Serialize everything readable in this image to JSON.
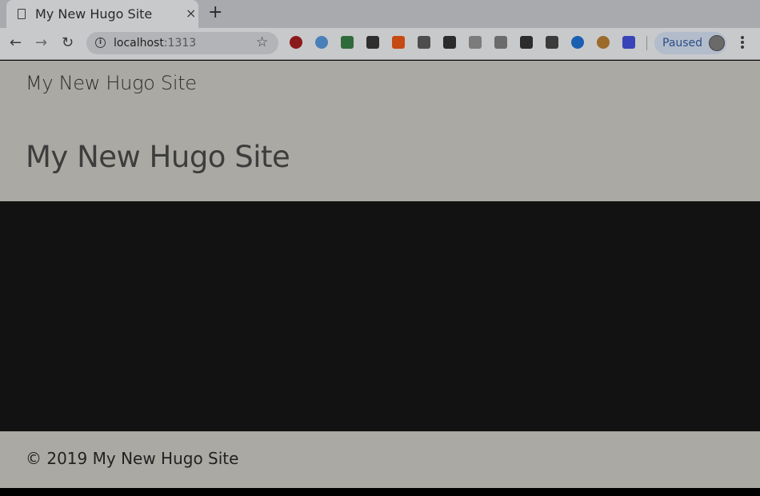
{
  "browser": {
    "tab": {
      "title": "My New Hugo Site",
      "close_glyph": "×"
    },
    "new_tab_glyph": "+",
    "url": {
      "host": "localhost",
      "port": ":1313"
    },
    "profile": {
      "status": "Paused"
    },
    "extensions": [
      {
        "name": "adblock-plus-icon",
        "color": "#8b1a1a"
      },
      {
        "name": "v-extension-icon",
        "color": "#4a80b8"
      },
      {
        "name": "evernote-icon",
        "color": "#2f6b3a"
      },
      {
        "name": "hat-icon",
        "color": "#2e2e2e"
      },
      {
        "name": "flower-icon",
        "color": "#c64a12"
      },
      {
        "name": "folder-icon",
        "color": "#4d4d4d"
      },
      {
        "name": "ninja-icon",
        "color": "#2b2b2b"
      },
      {
        "name": "shield-icon",
        "color": "#7c7c7c"
      },
      {
        "name": "puzzle-icon",
        "color": "#6b6b6b"
      },
      {
        "name": "film-icon",
        "color": "#2c2c2c"
      },
      {
        "name": "satellite-icon",
        "color": "#3b3b3b"
      },
      {
        "name": "blue-circle-icon",
        "color": "#1b5fb0"
      },
      {
        "name": "cookie-icon",
        "color": "#9c6a2a"
      },
      {
        "name": "color-bars-icon",
        "color": "#3844b8"
      }
    ]
  },
  "site": {
    "name": "My New Hugo Site",
    "hero_title": "My New Hugo Site",
    "footer_text": "© 2019 My New Hugo Site"
  }
}
